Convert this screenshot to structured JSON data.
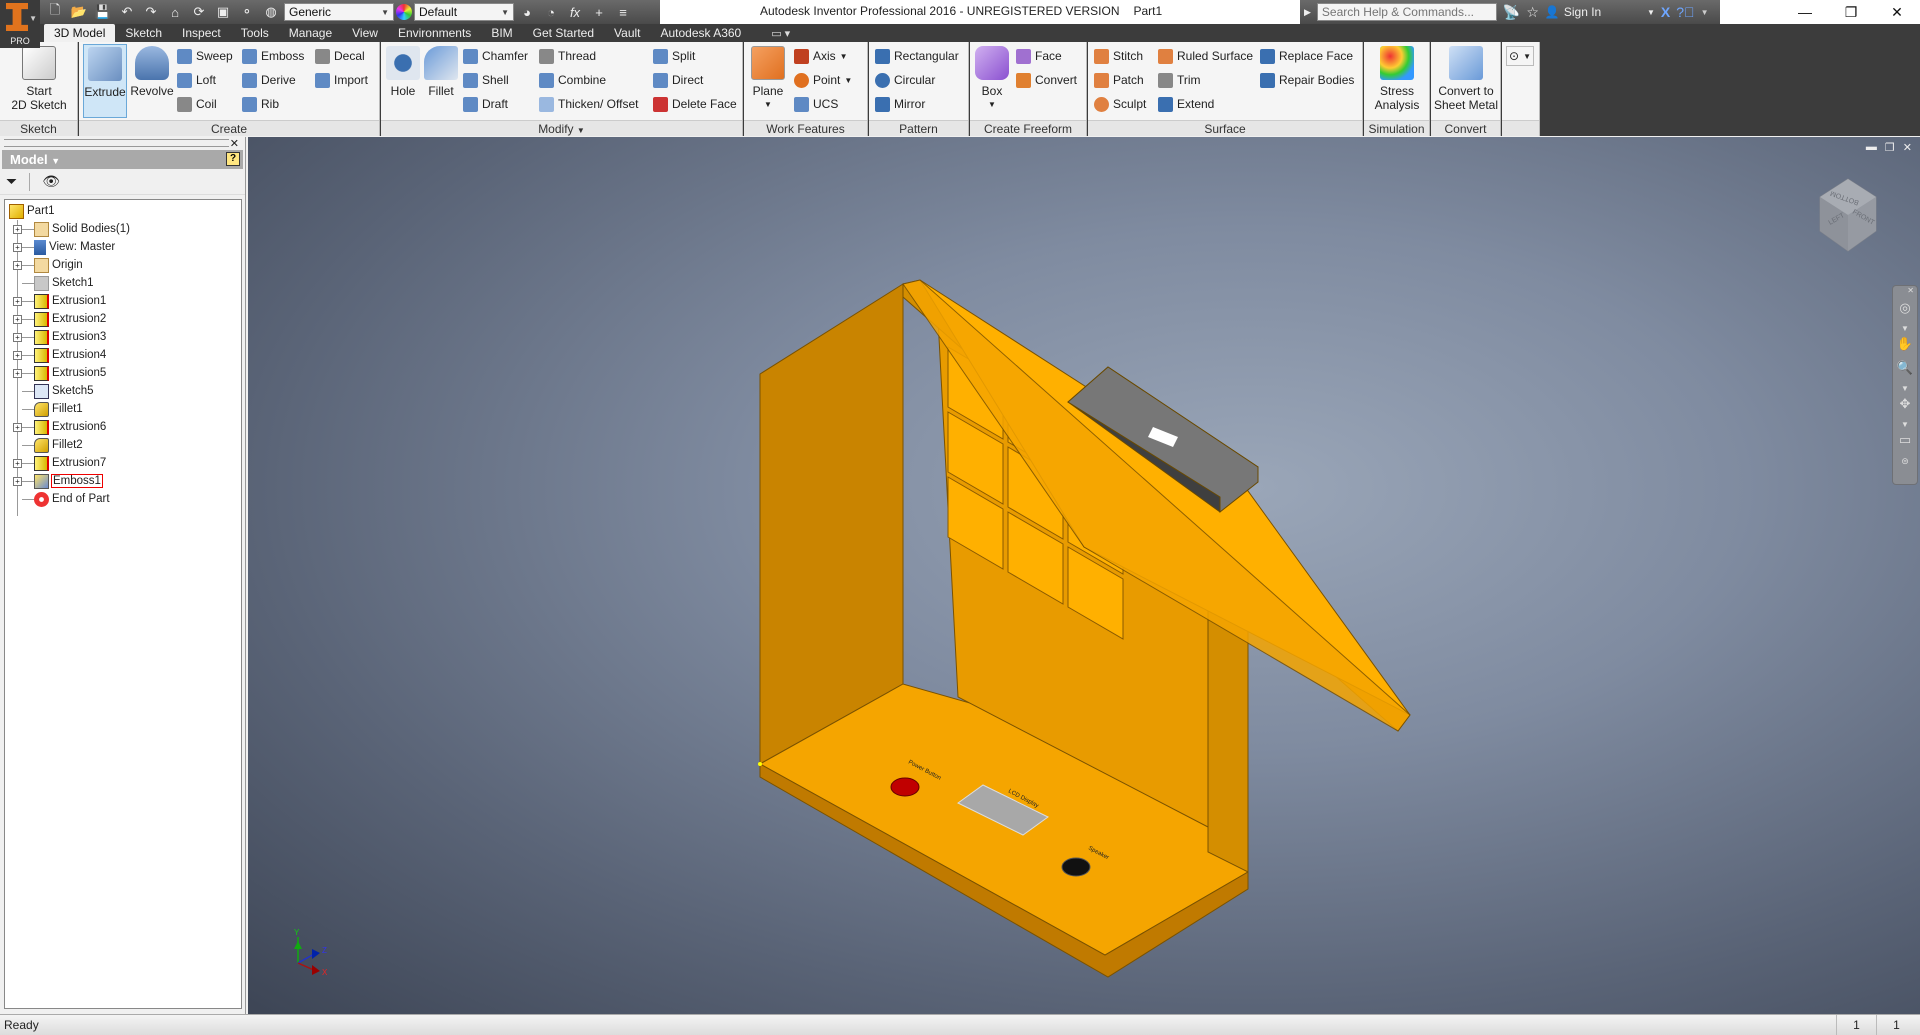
{
  "app": {
    "title": "Autodesk Inventor Professional 2016 - UNREGISTERED VERSION",
    "document": "Part1",
    "logo_badge": "PRO"
  },
  "quick_access": {
    "material_value": "Generic",
    "appearance_value": "Default"
  },
  "infocenter": {
    "search_placeholder": "Search Help & Commands...",
    "sign_in": "Sign In"
  },
  "tabs": [
    {
      "label": "3D Model",
      "active": true
    },
    {
      "label": "Sketch"
    },
    {
      "label": "Inspect"
    },
    {
      "label": "Tools"
    },
    {
      "label": "Manage"
    },
    {
      "label": "View"
    },
    {
      "label": "Environments"
    },
    {
      "label": "BIM"
    },
    {
      "label": "Get Started"
    },
    {
      "label": "Vault"
    },
    {
      "label": "Autodesk A360"
    }
  ],
  "ribbon": {
    "sketch": {
      "label": "Sketch",
      "start_line1": "Start",
      "start_line2": "2D Sketch"
    },
    "create": {
      "label": "Create",
      "extrude": "Extrude",
      "revolve": "Revolve",
      "col1": [
        "Sweep",
        "Loft",
        "Coil"
      ],
      "col2": [
        "Emboss",
        "Derive",
        "Rib"
      ],
      "col3": [
        "Decal",
        "Import"
      ]
    },
    "modify": {
      "label": "Modify",
      "hole": "Hole",
      "fillet": "Fillet",
      "col1": [
        "Chamfer",
        "Shell",
        "Draft"
      ],
      "col2": [
        "Thread",
        "Combine",
        "Thicken/ Offset"
      ],
      "col3": [
        "Split",
        "Direct",
        "Delete Face"
      ]
    },
    "work_features": {
      "label": "Work Features",
      "plane": "Plane",
      "col1": [
        "Axis",
        "Point",
        "UCS"
      ]
    },
    "pattern": {
      "label": "Pattern",
      "col1": [
        "Rectangular",
        "Circular",
        "Mirror"
      ]
    },
    "freeform": {
      "label": "Create Freeform",
      "box": "Box",
      "col1": [
        "Face",
        "Convert"
      ]
    },
    "surface": {
      "label": "Surface",
      "col1": [
        "Stitch",
        "Patch",
        "Sculpt"
      ],
      "col2": [
        "Ruled Surface",
        "Trim",
        "Extend"
      ],
      "col3": [
        "Replace Face",
        "Repair Bodies"
      ]
    },
    "simulation": {
      "label": "Simulation",
      "stress_line1": "Stress",
      "stress_line2": "Analysis"
    },
    "convert": {
      "label": "Convert",
      "sheet_line1": "Convert to",
      "sheet_line2": "Sheet Metal"
    }
  },
  "browser": {
    "header": "Model",
    "tree": [
      {
        "label": "Part1",
        "icon": "part-icon",
        "expandable": false,
        "root": true
      },
      {
        "label": "Solid Bodies(1)",
        "icon": "solid-bodies-folder-icon",
        "expandable": true
      },
      {
        "label": "View: Master",
        "icon": "view-rep-icon",
        "expandable": true
      },
      {
        "label": "Origin",
        "icon": "folder-icon",
        "expandable": true
      },
      {
        "label": "Sketch1",
        "icon": "sketch-consumed-icon",
        "expandable": false
      },
      {
        "label": "Extrusion1",
        "icon": "extrusion-icon",
        "expandable": true
      },
      {
        "label": "Extrusion2",
        "icon": "extrusion-icon",
        "expandable": true
      },
      {
        "label": "Extrusion3",
        "icon": "extrusion-icon",
        "expandable": true
      },
      {
        "label": "Extrusion4",
        "icon": "extrusion-icon",
        "expandable": true
      },
      {
        "label": "Extrusion5",
        "icon": "extrusion-icon",
        "expandable": true
      },
      {
        "label": "Sketch5",
        "icon": "sketch-icon",
        "expandable": false
      },
      {
        "label": "Fillet1",
        "icon": "fillet-icon",
        "expandable": false
      },
      {
        "label": "Extrusion6",
        "icon": "extrusion-icon",
        "expandable": true
      },
      {
        "label": "Fillet2",
        "icon": "fillet-icon",
        "expandable": false
      },
      {
        "label": "Extrusion7",
        "icon": "extrusion-icon",
        "expandable": true
      },
      {
        "label": "Emboss1",
        "icon": "emboss-icon",
        "expandable": true,
        "highlighted": true
      },
      {
        "label": "End of Part",
        "icon": "end-of-part-icon",
        "expandable": false
      }
    ]
  },
  "viewport": {
    "viewcube_faces": [
      "LEFT",
      "FRONT",
      "BOTTOM"
    ],
    "triad_axes": [
      "Y",
      "Z",
      "X"
    ],
    "model_labels": [
      "Power Button",
      "LCD Display",
      "Speaker"
    ]
  },
  "status": {
    "text": "Ready",
    "count1": "1",
    "count2": "1"
  },
  "colors": {
    "model_orange": "#f5a500",
    "model_dark_orange": "#c98400",
    "button_red": "#c00000",
    "lcd_housing": "#4a4a4a",
    "accent_selected": "#cfe6f7"
  }
}
